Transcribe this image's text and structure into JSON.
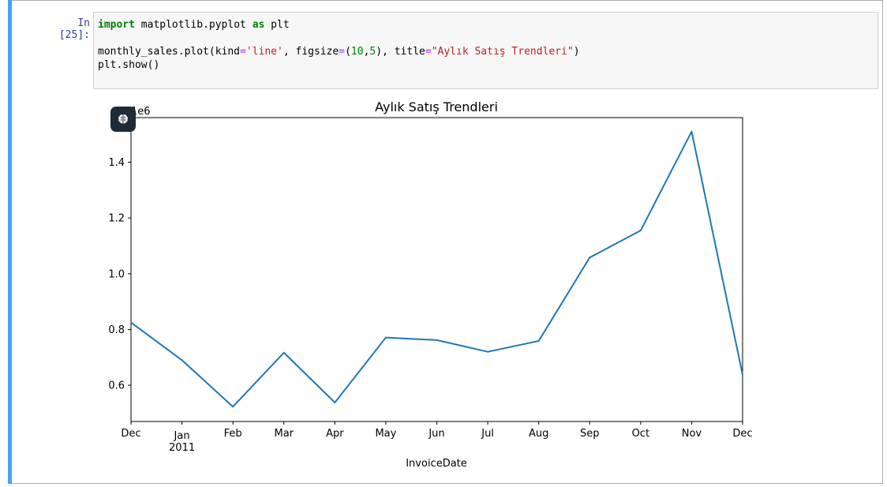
{
  "cell": {
    "prompt": "In [25]:",
    "code_lines": [
      [
        {
          "t": "import",
          "c": "kw"
        },
        {
          "t": " matplotlib.pyplot "
        },
        {
          "t": "as",
          "c": "kw"
        },
        {
          "t": " plt"
        }
      ],
      [],
      [
        {
          "t": "monthly_sales.plot(kind"
        },
        {
          "t": "=",
          "c": "op"
        },
        {
          "t": "'line'",
          "c": "str"
        },
        {
          "t": ", figsize"
        },
        {
          "t": "=",
          "c": "op"
        },
        {
          "t": "("
        },
        {
          "t": "10",
          "c": "num"
        },
        {
          "t": ","
        },
        {
          "t": "5",
          "c": "num"
        },
        {
          "t": "), title"
        },
        {
          "t": "=",
          "c": "op"
        },
        {
          "t": "\"Aylık Satış Trendleri\"",
          "c": "str"
        },
        {
          "t": ")"
        }
      ],
      [
        {
          "t": "plt.show()"
        }
      ]
    ]
  },
  "ai_button": {
    "icon": "brain-icon"
  },
  "chart_data": {
    "type": "line",
    "title": "Aylık Satış Trendleri",
    "xlabel": "InvoiceDate",
    "ylabel": "",
    "y_offset_label": "1e6",
    "categories": [
      "Dec",
      "Jan",
      "Feb",
      "Mar",
      "Apr",
      "May",
      "Jun",
      "Jul",
      "Aug",
      "Sep",
      "Oct",
      "Nov",
      "Dec"
    ],
    "year_label": "2011",
    "year_label_under": "Jan",
    "values": [
      825000,
      690000,
      523000,
      717000,
      538000,
      771000,
      762000,
      720000,
      759000,
      1058000,
      1155000,
      1510000,
      638000
    ],
    "ylim": [
      0.47,
      1.56
    ],
    "yticks": [
      0.6,
      0.8,
      1.0,
      1.2,
      1.4
    ],
    "ytick_labels": [
      "0.6",
      "0.8",
      "1.0",
      "1.2",
      "1.4"
    ],
    "line_color": "#1f77b4",
    "grid": false
  }
}
